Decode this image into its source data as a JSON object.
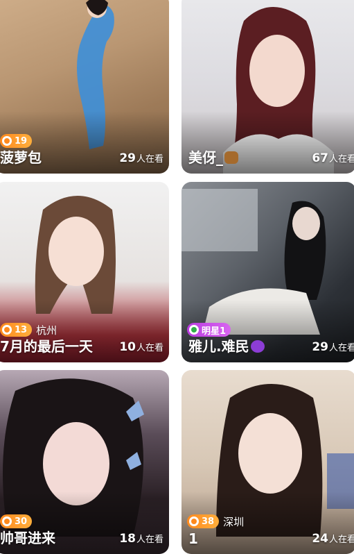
{
  "cards": [
    {
      "name": "菠萝包",
      "level": "19",
      "badge_type": "level",
      "city": "",
      "viewers": "29",
      "viewers_unit": "人在看"
    },
    {
      "name": "美伢_",
      "level": "",
      "badge_type": "",
      "city": "",
      "viewers": "67",
      "viewers_unit": "人在看",
      "emoji": "bear"
    },
    {
      "name": "7月的最后一天",
      "level": "13",
      "badge_type": "level",
      "city": "杭州",
      "viewers": "10",
      "viewers_unit": "人在看"
    },
    {
      "name": "雅儿.难民",
      "level": "明星1",
      "badge_type": "star",
      "city": "",
      "viewers": "29",
      "viewers_unit": "人在看",
      "emoji": "capricorn"
    },
    {
      "name": "帅哥进来",
      "level": "30",
      "badge_type": "level",
      "city": "",
      "viewers": "18",
      "viewers_unit": "人在看"
    },
    {
      "name": "1",
      "level": "38",
      "badge_type": "level",
      "city": "深圳",
      "viewers": "24",
      "viewers_unit": "人在看"
    }
  ],
  "colors": {
    "level_badge": "#ff8a1e",
    "star_badge": "#c84ee6"
  }
}
